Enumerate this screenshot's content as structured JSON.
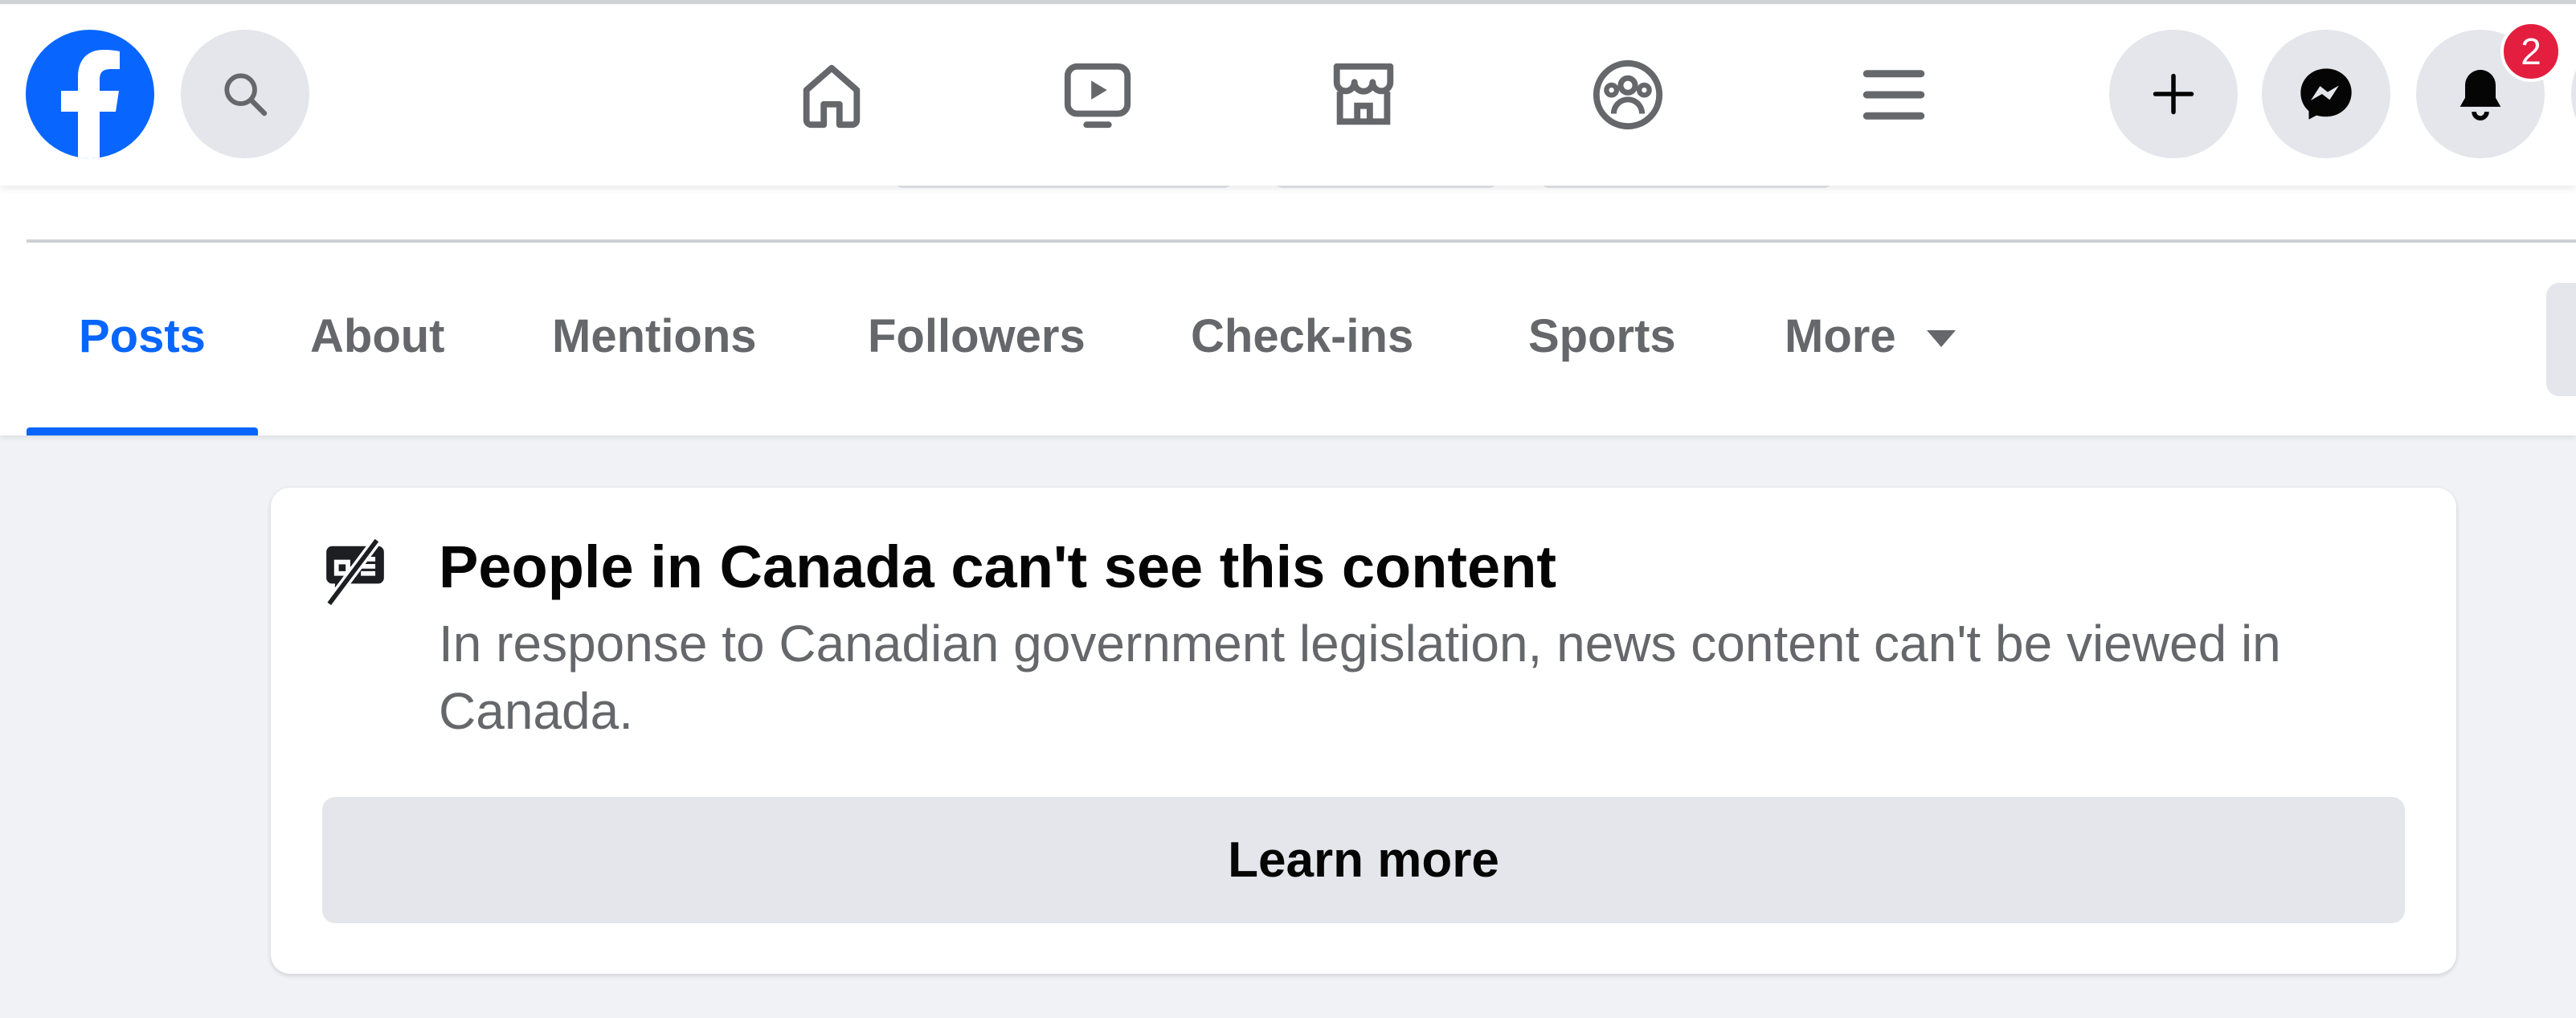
{
  "header": {
    "notification_count": "2",
    "icons": [
      "facebook-logo",
      "search-icon",
      "home-icon",
      "video-icon",
      "marketplace-icon",
      "groups-icon",
      "menu-icon",
      "plus-icon",
      "messenger-icon",
      "bell-icon"
    ]
  },
  "tabs": [
    {
      "label": "Posts",
      "active": true
    },
    {
      "label": "About"
    },
    {
      "label": "Mentions"
    },
    {
      "label": "Followers"
    },
    {
      "label": "Check-ins"
    },
    {
      "label": "Sports"
    },
    {
      "label": "More"
    }
  ],
  "notice": {
    "title": "People in Canada can't see this content",
    "body": "In response to Canadian government legislation, news content can't be viewed in Canada.",
    "button": "Learn more",
    "icon": "news-blocked-icon"
  },
  "colors": {
    "accent": "#0866ff",
    "badge": "#e41e3f",
    "background": "#f0f2f5"
  }
}
